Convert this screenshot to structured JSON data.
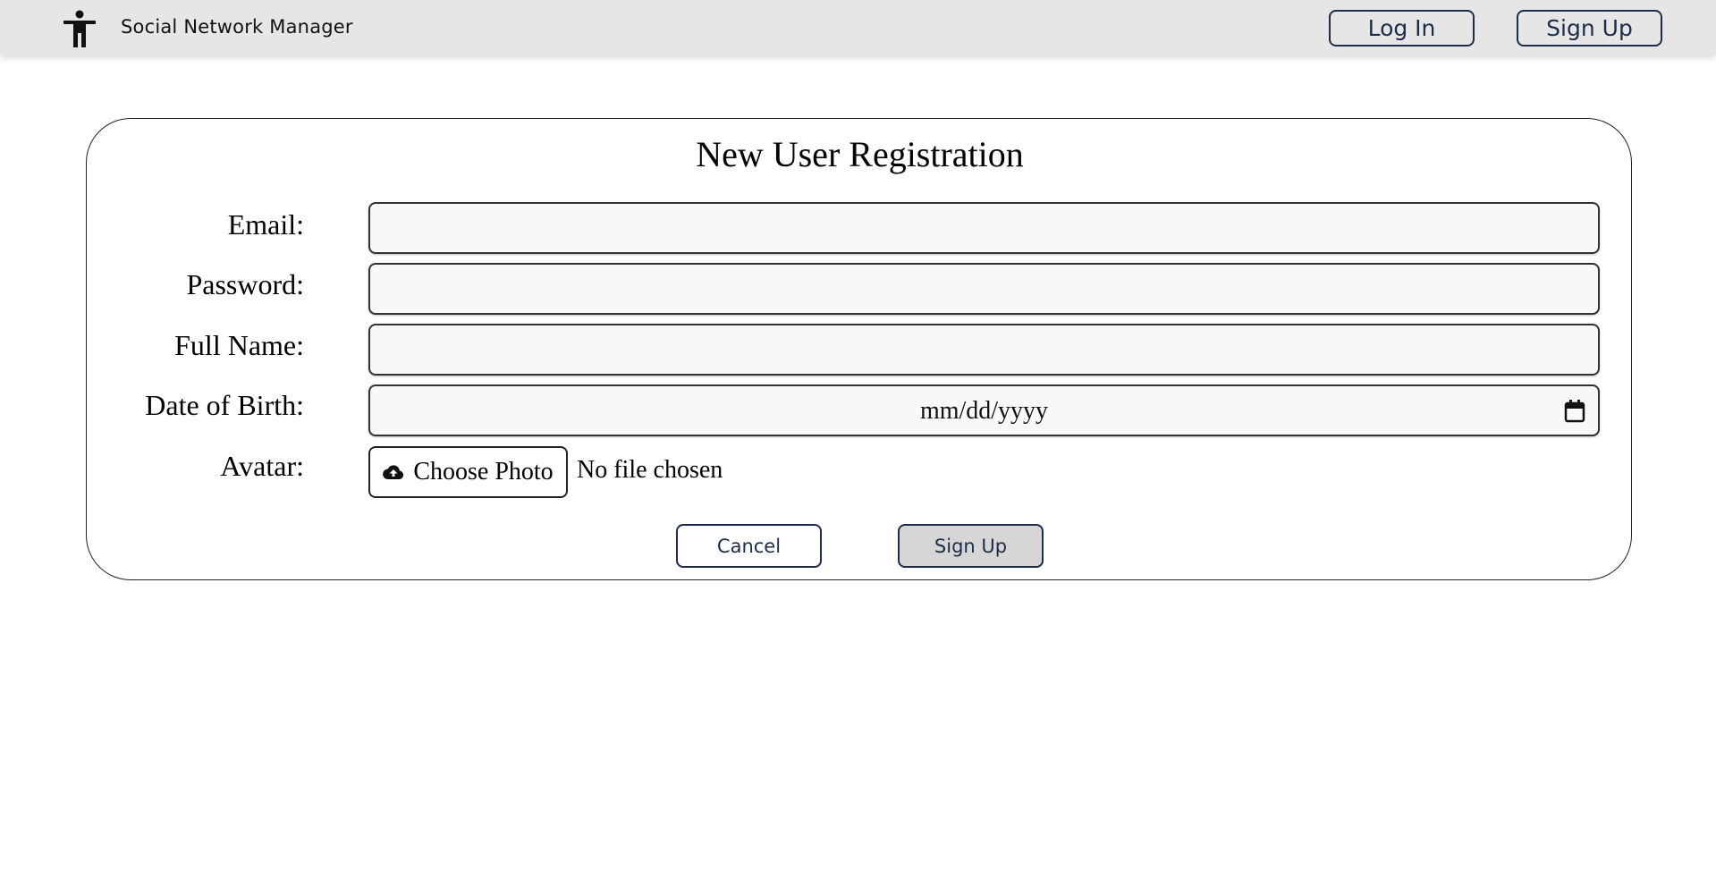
{
  "header": {
    "app_title": "Social Network Manager",
    "logo_icon": "accessibility-person-icon",
    "login_label": "Log In",
    "signup_label": "Sign Up"
  },
  "form": {
    "title": "New User Registration",
    "fields": {
      "email": {
        "label": "Email:",
        "value": ""
      },
      "password": {
        "label": "Password:",
        "value": ""
      },
      "full_name": {
        "label": "Full Name:",
        "value": ""
      },
      "dob": {
        "label": "Date of Birth:",
        "placeholder": "mm/dd/yyyy",
        "icon": "calendar-icon"
      },
      "avatar": {
        "label": "Avatar:",
        "button_label": "Choose Photo",
        "button_icon": "cloud-upload-icon",
        "status": "No file chosen"
      }
    },
    "cancel_label": "Cancel",
    "submit_label": "Sign Up"
  },
  "colors": {
    "header_bg": "#e6e6e6",
    "button_border": "#1c2d4a",
    "submit_bg": "#d6d6d6"
  }
}
